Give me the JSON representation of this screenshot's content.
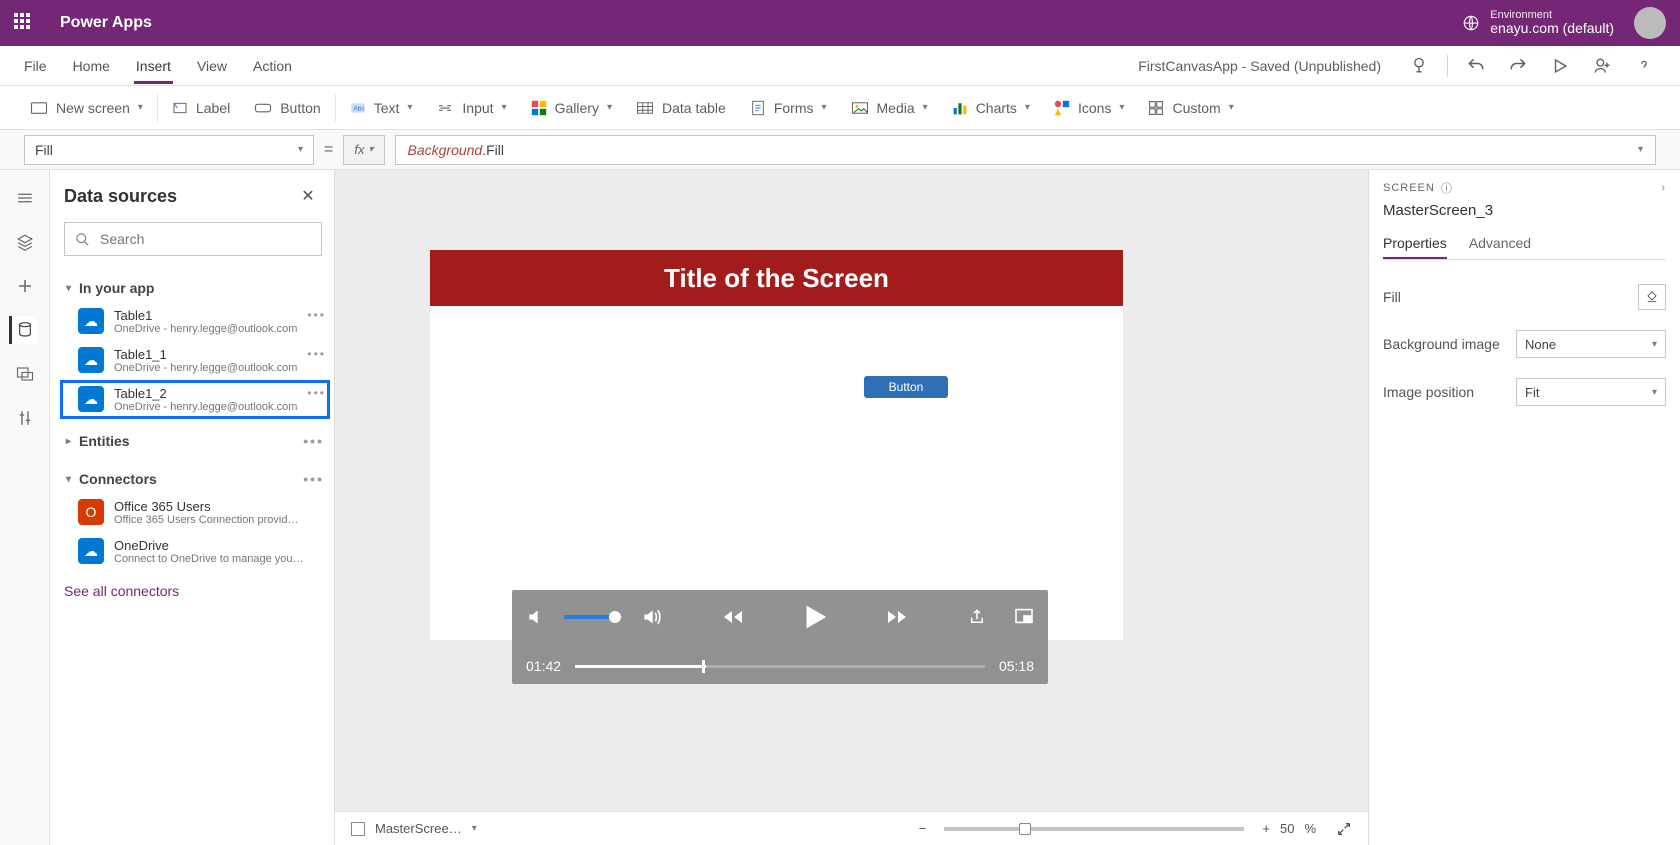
{
  "titlebar": {
    "app_name": "Power Apps",
    "env_label": "Environment",
    "env_value": "enayu.com (default)"
  },
  "menubar": {
    "items": [
      "File",
      "Home",
      "Insert",
      "View",
      "Action"
    ],
    "active_index": 2,
    "doc_status": "FirstCanvasApp - Saved (Unpublished)"
  },
  "ribbon": {
    "new_screen": "New screen",
    "label": "Label",
    "button": "Button",
    "text": "Text",
    "input": "Input",
    "gallery": "Gallery",
    "data_table": "Data table",
    "forms": "Forms",
    "media": "Media",
    "charts": "Charts",
    "icons": "Icons",
    "custom": "Custom"
  },
  "formula": {
    "property": "Fill",
    "fx": "fx",
    "expr_left": "Background",
    "expr_right": ".Fill"
  },
  "side": {
    "title": "Data sources",
    "search_placeholder": "Search",
    "sections": {
      "in_app": "In your app",
      "entities": "Entities",
      "connectors": "Connectors"
    },
    "in_app_items": [
      {
        "name": "Table1",
        "sub": "OneDrive - henry.legge@outlook.com"
      },
      {
        "name": "Table1_1",
        "sub": "OneDrive - henry.legge@outlook.com"
      },
      {
        "name": "Table1_2",
        "sub": "OneDrive - henry.legge@outlook.com"
      }
    ],
    "selected_index": 2,
    "connectors": [
      {
        "name": "Office 365 Users",
        "sub": "Office 365 Users Connection provider lets you …",
        "icon": "orange"
      },
      {
        "name": "OneDrive",
        "sub": "Connect to OneDrive to manage your files. Yo…",
        "icon": "blue"
      }
    ],
    "see_all": "See all connectors"
  },
  "canvas": {
    "title": "Title of the Screen",
    "button_label": "Button"
  },
  "video": {
    "current": "01:42",
    "total": "05:18"
  },
  "status": {
    "screen": "MasterScree…",
    "zoom": "50",
    "zoom_unit": "%"
  },
  "prop": {
    "panel_label": "SCREEN",
    "screen_name": "MasterScreen_3",
    "tab_properties": "Properties",
    "tab_advanced": "Advanced",
    "fill_label": "Fill",
    "bg_image_label": "Background image",
    "bg_image_value": "None",
    "img_pos_label": "Image position",
    "img_pos_value": "Fit"
  }
}
